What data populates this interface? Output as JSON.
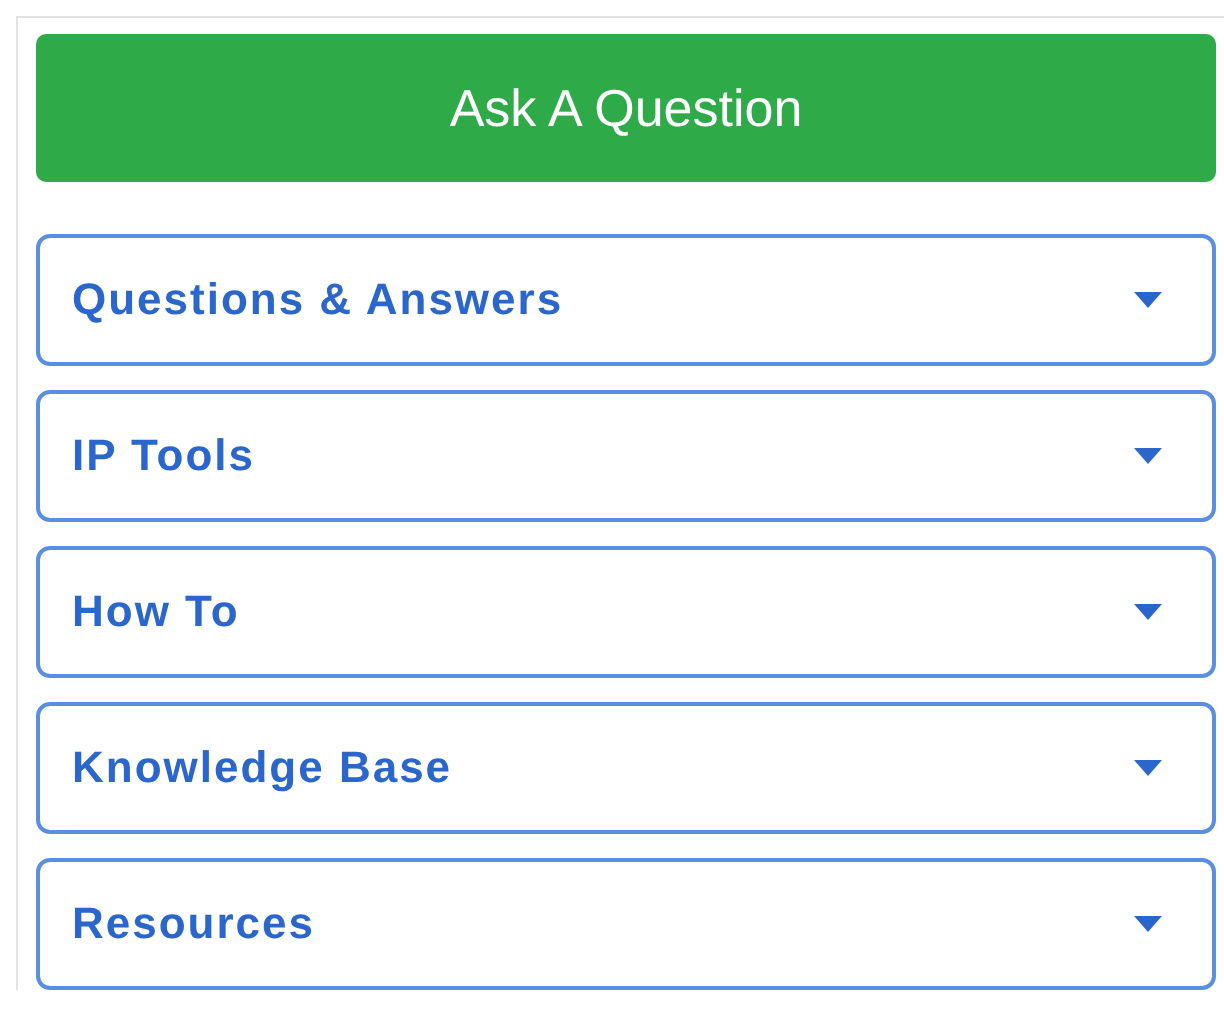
{
  "ask_button": {
    "label": "Ask A Question"
  },
  "menu": [
    {
      "label": "Questions & Answers",
      "expanded": false
    },
    {
      "label": "IP Tools",
      "expanded": false
    },
    {
      "label": "How To",
      "expanded": false
    },
    {
      "label": "Knowledge Base",
      "expanded": false
    },
    {
      "label": "Resources",
      "expanded": false
    }
  ]
}
